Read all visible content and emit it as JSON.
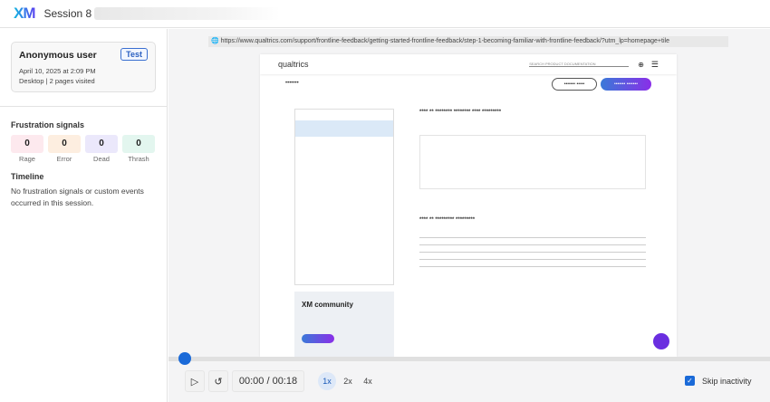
{
  "header": {
    "logo": "XM",
    "title": "Session 8"
  },
  "user": {
    "name": "Anonymous user",
    "badge": "Test",
    "date": "April 10, 2025 at 2:09 PM",
    "device": "Desktop | 2 pages visited"
  },
  "frustration": {
    "title": "Frustration signals",
    "items": [
      {
        "label": "Rage",
        "count": "0",
        "color": "#fde9ee"
      },
      {
        "label": "Error",
        "count": "0",
        "color": "#fdeee0"
      },
      {
        "label": "Dead",
        "count": "0",
        "color": "#ebe8fb"
      },
      {
        "label": "Thrash",
        "count": "0",
        "color": "#e3f6ef"
      }
    ]
  },
  "timeline": {
    "title": "Timeline",
    "empty": "No frustration signals or custom events occurred in this session."
  },
  "replay": {
    "url": "https://www.qualtrics.com/support/frontline-feedback/getting-started-frontline-feedback/step-1-becoming-familiar-with-frontline-feedback/?utm_lp=homepage+tile",
    "site_logo": "qualtrics",
    "search_placeholder": "SEARCH PRODUCT DOCUMENTATION",
    "community": "XM community"
  },
  "player": {
    "time": "00:00 / 00:18",
    "progress": 0,
    "speeds": [
      "1x",
      "2x",
      "4x"
    ],
    "selected_speed": "1x",
    "skip_label": "Skip inactivity",
    "skip_checked": true,
    "accent": "#1a6ad8"
  }
}
